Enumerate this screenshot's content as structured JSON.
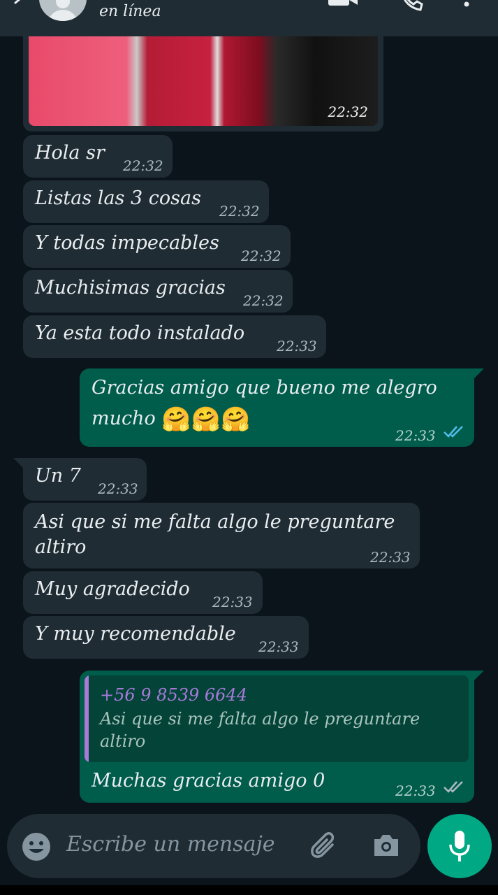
{
  "header": {
    "status": "en línea"
  },
  "messages": [
    {
      "text": "Hola sr",
      "time": "22:32"
    },
    {
      "text": "Listas las 3 cosas",
      "time": "22:32"
    },
    {
      "text": "Y todas impecables",
      "time": "22:32"
    },
    {
      "text": "Muchisimas gracias",
      "time": "22:32"
    },
    {
      "text": "Ya esta todo instalado",
      "time": "22:33"
    }
  ],
  "image_message": {
    "time": "22:32"
  },
  "outgoing_1": {
    "line1": "Gracias amigo que bueno me alegro",
    "line2": "mucho",
    "emojis": "🤗🤗🤗",
    "time": "22:33"
  },
  "incoming_2": [
    {
      "text": "Un 7",
      "time": "22:33"
    },
    {
      "line1": "Asi que si me falta algo le preguntare",
      "line2": "altiro",
      "time": "22:33"
    },
    {
      "text": "Muy agradecido",
      "time": "22:33"
    },
    {
      "text": "Y muy recomendable",
      "time": "22:33"
    }
  ],
  "reply": {
    "quote_author": "+56 9 8539 6644",
    "quote_text": "Asi que si me falta algo le preguntare altiro",
    "text": "Muchas gracias amigo 0",
    "time": "22:33"
  },
  "input": {
    "placeholder": "Escribe un mensaje"
  },
  "colors": {
    "background": "#0b141a",
    "incoming_bubble": "#1f2c34",
    "outgoing_bubble": "#005c4b",
    "accent": "#00a884",
    "read_ticks": "#53bdeb"
  },
  "icons": [
    "back-arrow-icon",
    "avatar",
    "video-call-icon",
    "phone-icon",
    "more-options-icon",
    "emoji-icon",
    "attach-icon",
    "camera-icon",
    "mic-icon"
  ]
}
